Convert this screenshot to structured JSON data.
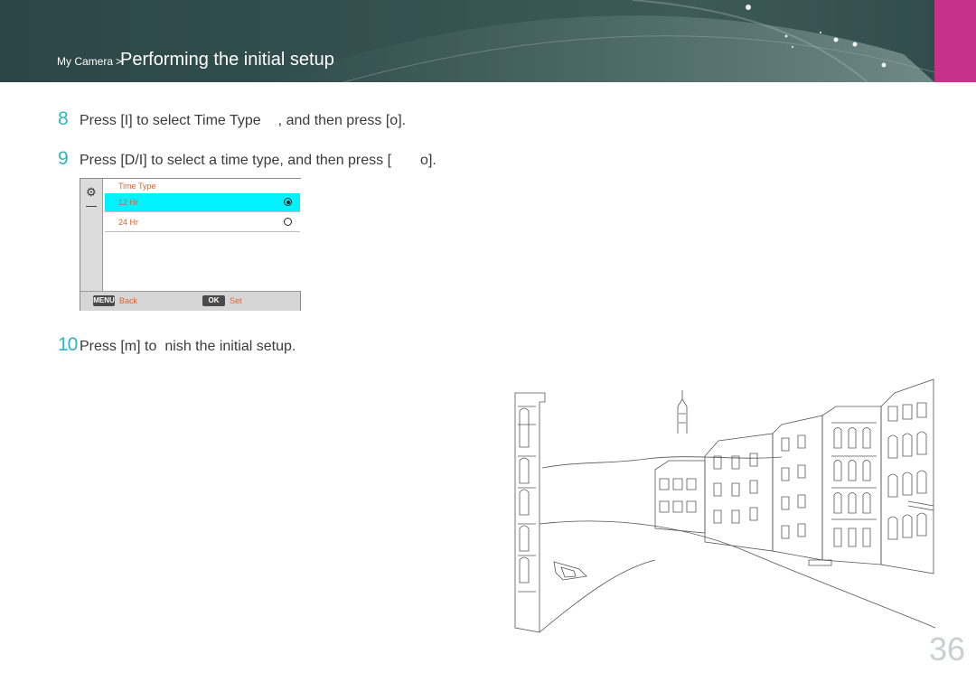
{
  "header": {
    "section": "My Camera",
    "separator": ">",
    "title": "Performing the initial setup"
  },
  "steps": [
    {
      "num": "8",
      "text_a": "Press [I] to select Time Type",
      "text_b": ", and then press [o]."
    },
    {
      "num": "9",
      "text_a": "Press [D/I] to select a time type, and then press [",
      "text_b": "o]."
    },
    {
      "num": "10",
      "text_a": "Press [m] to",
      "text_b": "nish the initial setup."
    }
  ],
  "camera_screen": {
    "title": "Time Type",
    "options": [
      {
        "label": "12 Hr",
        "selected": true
      },
      {
        "label": "24 Hr",
        "selected": false
      }
    ],
    "footer": {
      "menu_key": "MENU",
      "back_label": "Back",
      "ok_key": "OK",
      "set_label": "Set"
    }
  },
  "page_number": "36",
  "colors": {
    "header_bg": "#34504f",
    "accent_pink": "#c4328a",
    "step_number": "#2eb5bf",
    "menu_highlight": "#00f2ff",
    "menu_text": "#e8602c"
  }
}
